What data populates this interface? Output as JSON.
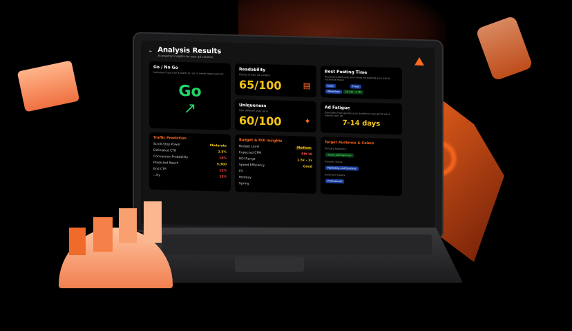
{
  "header": {
    "title": "Analysis Results",
    "subtitle": "AI-powered insights for your ad creative",
    "back_icon": "arrow-left-icon"
  },
  "cards": {
    "go": {
      "title": "Go / No Go",
      "desc": "Indicates if your ad is ready to run or needs improvement",
      "value": "Go"
    },
    "readability": {
      "title": "Readability",
      "desc": "Clarity of your ad content",
      "value": "65/100"
    },
    "posting": {
      "title": "Best Posting Time",
      "desc": "Recommended days and times for posting your ads to maximize reach",
      "days_label": "Days",
      "times_label": "Times",
      "days": "Weekdays",
      "times": "10 AM - 2 PM"
    },
    "uniqueness": {
      "title": "Uniqueness",
      "desc": "How different your ad is",
      "value": "60/100"
    },
    "fatigue": {
      "title": "Ad Fatigue",
      "desc": "Estimates how quickly your audience may get tired of seeing your ad",
      "value": "7-14 days"
    }
  },
  "traffic": {
    "title": "Traffic Prediction",
    "rows": [
      {
        "label": "Scroll-Stop Power",
        "value": "Moderate"
      },
      {
        "label": "Estimated CTR",
        "value": "2.5%"
      },
      {
        "label": "Conversion Probability",
        "value": "10%"
      },
      {
        "label": "Predicted Reach",
        "value": "5,300"
      },
      {
        "label": "End CTR",
        "value": "12%"
      },
      {
        "label": "...ity",
        "value": "15%"
      }
    ]
  },
  "budget": {
    "title": "Budget & ROI Insights",
    "rows": [
      {
        "label": "Budget Level",
        "value": "Medium"
      },
      {
        "label": "Expected CPM",
        "value": "RM 10"
      },
      {
        "label": "ROI Range",
        "value": "1.5x - 3x"
      },
      {
        "label": "Spend Efficiency",
        "value": "Good"
      }
    ],
    "extra": [
      "EV",
      "ROI/day",
      "Spring"
    ]
  },
  "audience": {
    "title": "Target Audience & Colors",
    "primary_label": "Primary Audience",
    "primary": "Young professionals",
    "industry_label": "Industry Focus",
    "industry": "Marketing and Business",
    "colors_label": "Dominant Colors",
    "colors": "Professional"
  },
  "colors": {
    "accent": "#ff6a1f",
    "go": "#22d468",
    "score": "#f5c518"
  }
}
